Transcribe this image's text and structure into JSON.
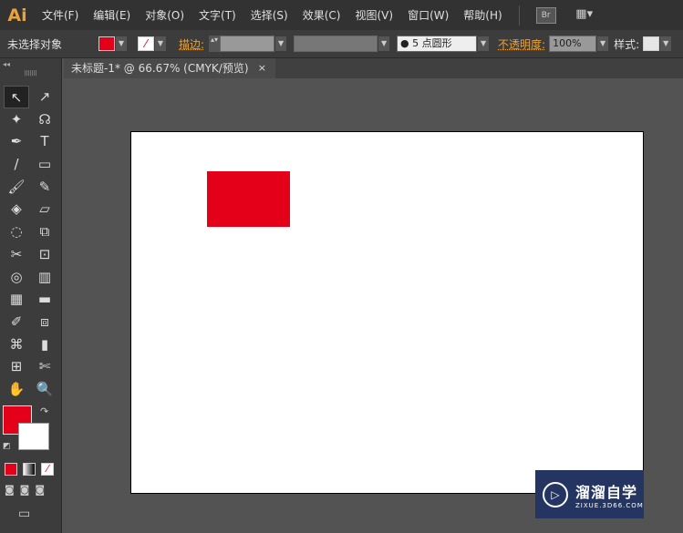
{
  "app": {
    "logo": "Ai"
  },
  "menu": [
    "文件(F)",
    "编辑(E)",
    "对象(O)",
    "文字(T)",
    "选择(S)",
    "效果(C)",
    "视图(V)",
    "窗口(W)",
    "帮助(H)"
  ],
  "menu_buttons": {
    "bridge": "Br",
    "workspace": "▦▾"
  },
  "control": {
    "selection": "未选择对象",
    "stroke_label": "描边:",
    "brush": "5 点圆形",
    "opacity_label": "不透明度:",
    "opacity": "100%",
    "style_label": "样式:"
  },
  "document_tab": {
    "title": "未标题-1* @ 66.67% (CMYK/预览)",
    "close": "×"
  },
  "tools": [
    "↖",
    "↗",
    "✦",
    "☊",
    "✒",
    "T",
    "/",
    "▭",
    "🖌",
    "✎",
    "◈",
    "▱",
    "◌",
    "⧉",
    "✂",
    "⊡",
    "◎",
    "▥",
    "▦",
    "▬",
    "✐",
    "⧈",
    "⌘",
    "▮",
    "⊞",
    "✄",
    "✋",
    "🔍"
  ],
  "colors": {
    "fill": "#e5001a",
    "shape": "#e5001a",
    "accent": "#e8a33b"
  },
  "watermark": {
    "name": "溜溜自学",
    "url": "ZIXUE.3D66.COM"
  }
}
